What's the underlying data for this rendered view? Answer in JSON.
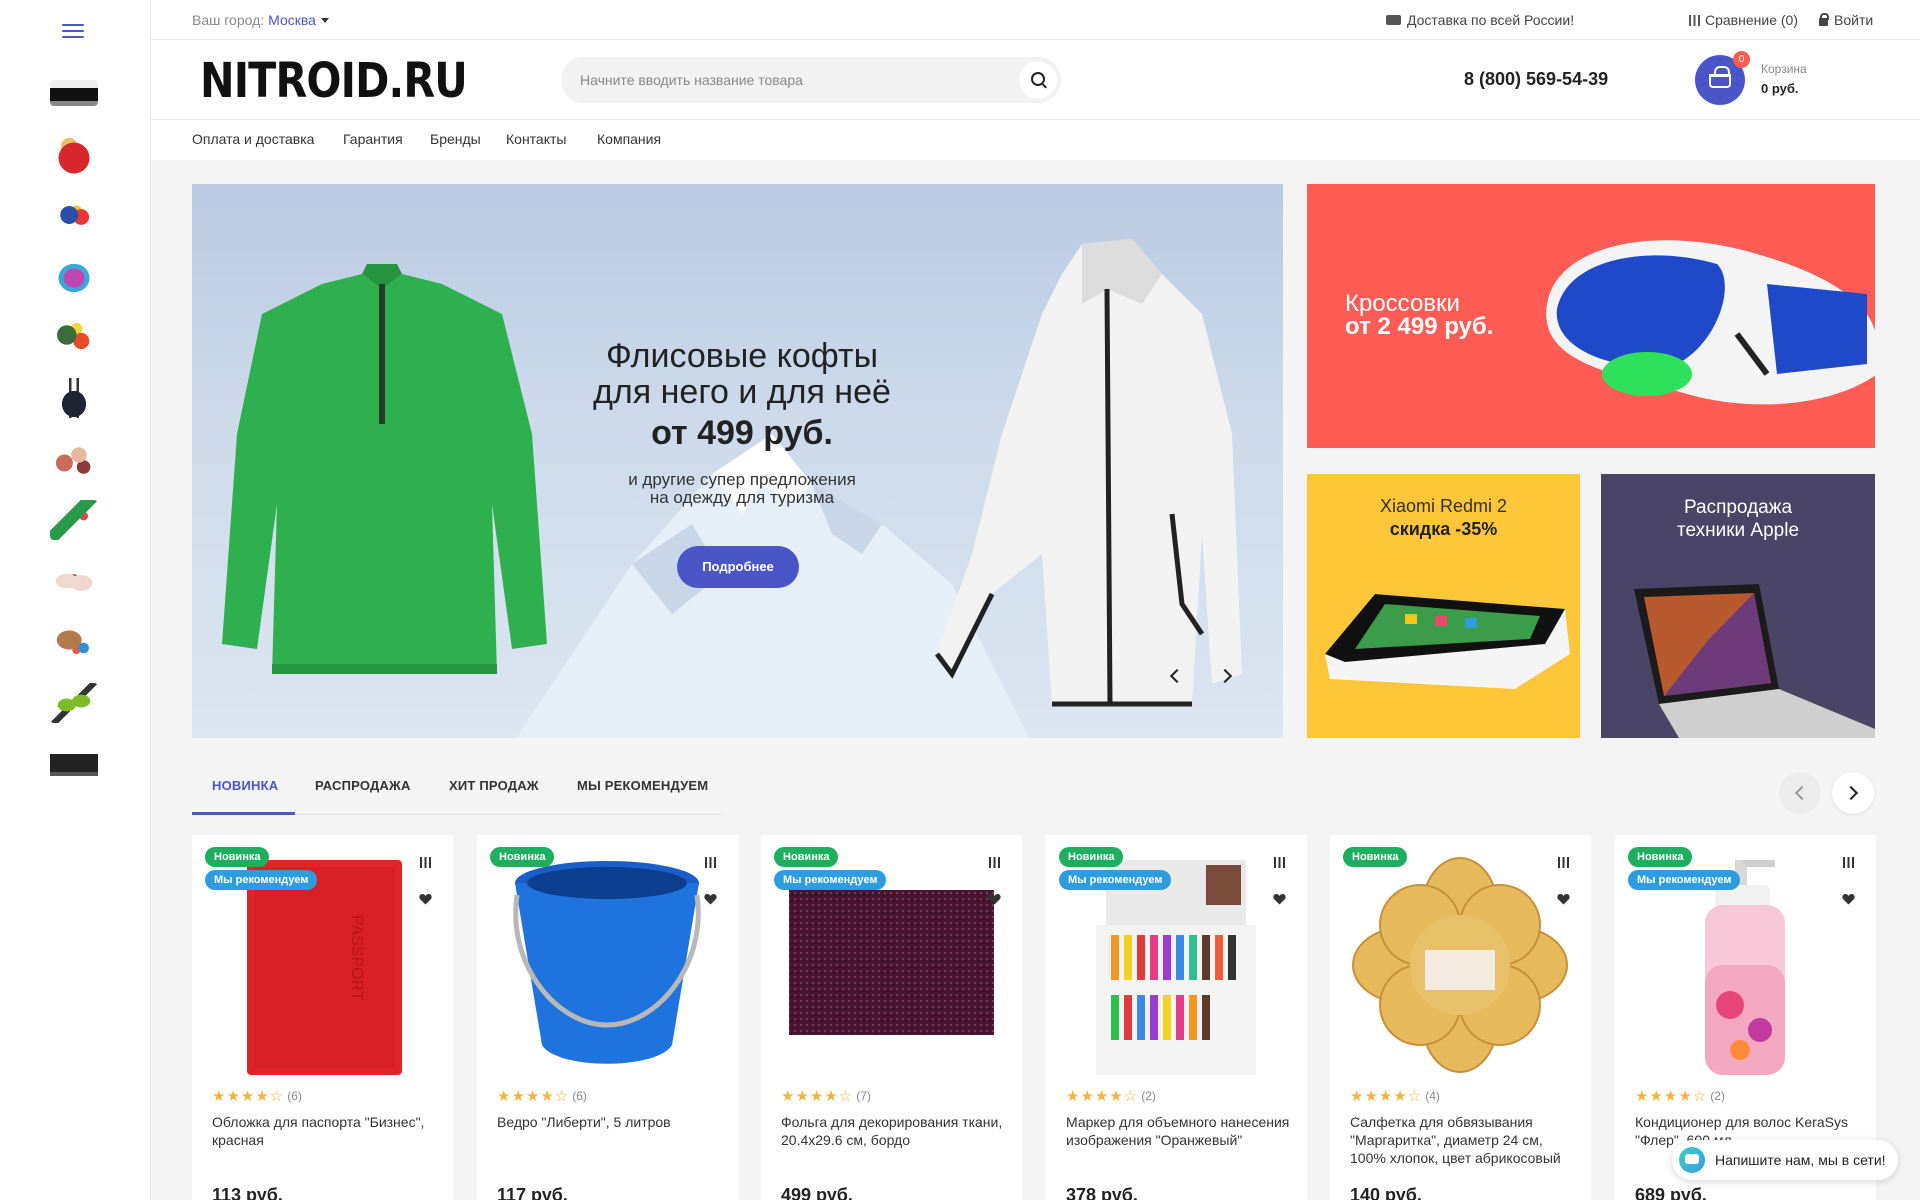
{
  "topbar": {
    "city_label": "Ваш город:",
    "city_value": "Москва",
    "delivery": "Доставка по всей России!",
    "compare": "Сравнение (0)",
    "login": "Войти"
  },
  "header": {
    "logo": "NITROID.RU",
    "search_placeholder": "Начните вводить название товара",
    "phone": "8 (800) 569-54-39",
    "cart_count": "0",
    "cart_label": "Корзина",
    "cart_sum": "0 руб."
  },
  "nav": [
    "Оплата и доставка",
    "Гарантия",
    "Бренды",
    "Контакты",
    "Компания"
  ],
  "banner": {
    "title_line1": "Флисовые кофты",
    "title_line2": "для него и для неё",
    "price": "от 499 руб.",
    "sub_line1": "и другие супер предложения",
    "sub_line2": "на одежду для туризма",
    "button": "Подробнее"
  },
  "side_banners": {
    "sneakers_line1": "Кроссовки",
    "sneakers_line2": "от 2 499 руб.",
    "xiaomi_title": "Xiaomi Redmi 2",
    "xiaomi_sub": "скидка -35%",
    "apple_line1": "Распродажа",
    "apple_line2": "техники Apple"
  },
  "tabs": [
    "НОВИНКА",
    "РАСПРОДАЖА",
    "ХИТ ПРОДАЖ",
    "МЫ РЕКОМЕНДУЕМ"
  ],
  "badges": {
    "new": "Новинка",
    "recommended": "Мы рекомендуем"
  },
  "products": [
    {
      "name": "Обложка для паспорта \"Бизнес\", красная",
      "price": "113 руб.",
      "rating": 4,
      "reviews": "(6)",
      "recommended": true
    },
    {
      "name": "Ведро \"Либерти\", 5 литров",
      "price": "117 руб.",
      "rating": 4,
      "reviews": "(6)",
      "recommended": false
    },
    {
      "name": "Фольга для декорирования ткани, 20.4x29.6 см, бордо",
      "price": "499 руб.",
      "rating": 4,
      "reviews": "(7)",
      "recommended": true
    },
    {
      "name": "Маркер для объемного нанесения изображения \"Оранжевый\"",
      "price": "378 руб.",
      "rating": 4,
      "reviews": "(2)",
      "recommended": true
    },
    {
      "name": "Салфетка для обвязывания \"Маргаритка\", диаметр 24 см, 100% хлопок, цвет абрикосовый",
      "price": "140 руб.",
      "rating": 4,
      "reviews": "(4)",
      "recommended": false
    },
    {
      "name": "Кондиционер для волос KeraSys \"Флер\", 600 мл",
      "price": "689 руб.",
      "rating": 4,
      "reviews": "(2)",
      "recommended": true
    }
  ],
  "chat": {
    "text": "Напишите нам, мы в сети!"
  },
  "colors": {
    "accent": "#4a56c8",
    "new_badge": "#1eae5d",
    "rec_badge": "#2d9de0",
    "sale_red": "#ff5c55"
  }
}
